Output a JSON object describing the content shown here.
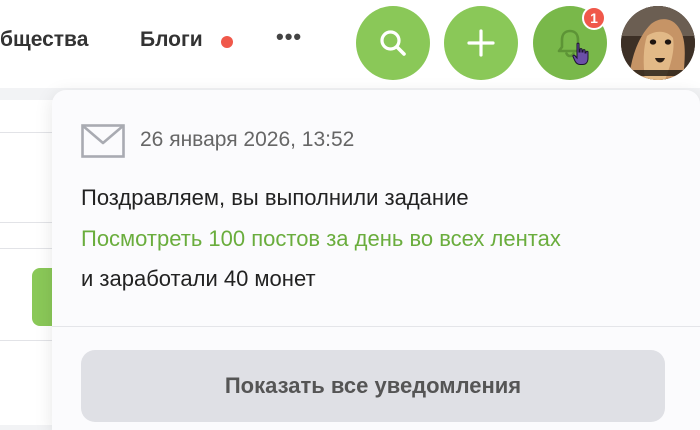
{
  "nav": {
    "communities_label": "бщества",
    "blogs_label": "Блоги",
    "more_label": "•••"
  },
  "header": {
    "notification_count": "1",
    "accent_color": "#8ac858",
    "badge_color": "#f0584a"
  },
  "notification": {
    "date": "26 января 2026, 13:52",
    "line1": "Поздравляем, вы выполнили задание",
    "task_link": "Посмотреть 100 постов за день во всех лентах",
    "line3": "и заработали 40 монет"
  },
  "dropdown": {
    "show_all_label": "Показать все уведомления"
  }
}
